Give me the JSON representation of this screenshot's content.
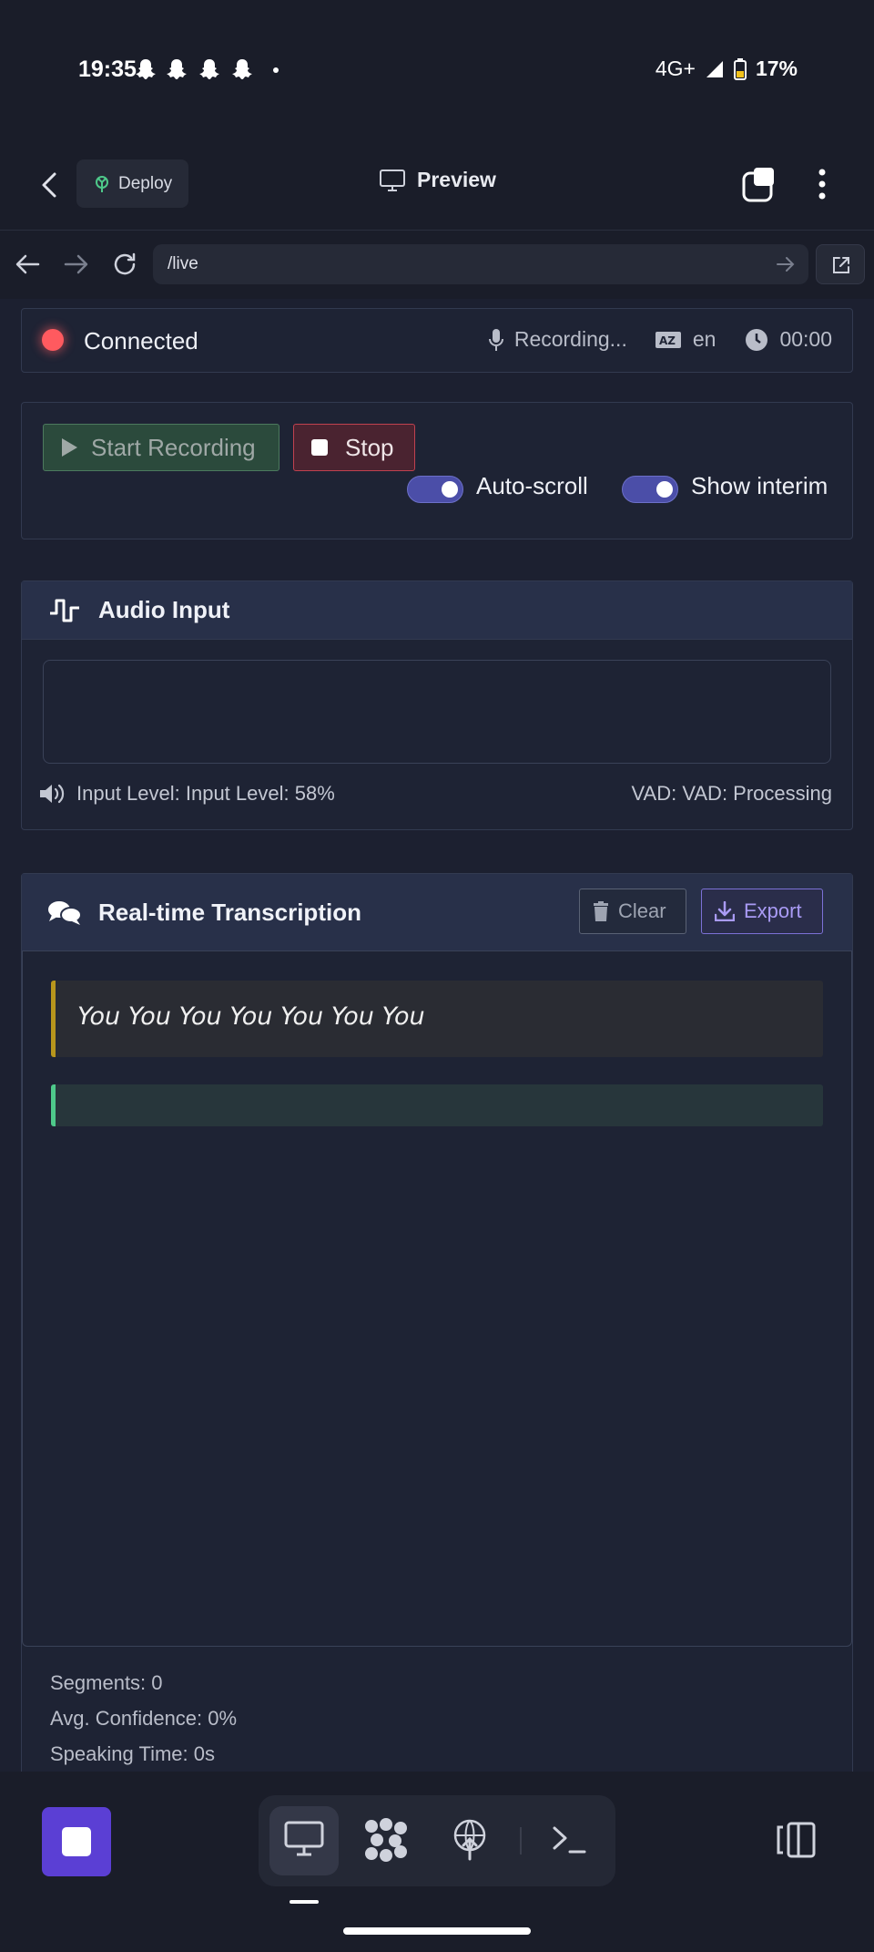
{
  "status_bar": {
    "time": "19:35",
    "network": "4G+",
    "battery": "17%"
  },
  "header": {
    "deploy_label": "Deploy",
    "preview_label": "Preview"
  },
  "url_bar": {
    "path": "/live"
  },
  "connection": {
    "status": "Connected",
    "recording": "Recording...",
    "language": "en",
    "timer": "00:00"
  },
  "controls": {
    "start_label": "Start Recording",
    "stop_label": "Stop",
    "autoscroll_label": "Auto-scroll",
    "interim_label": "Show interim",
    "autoscroll_on": true,
    "interim_on": true
  },
  "audio": {
    "title": "Audio Input",
    "level": "Input Level: Input Level: 58%",
    "vad": "VAD: VAD: Processing"
  },
  "transcription": {
    "title": "Real-time Transcription",
    "clear_label": "Clear",
    "export_label": "Export",
    "segment_text": "You You You You You You You",
    "stats": {
      "segments": "Segments: 0",
      "confidence": "Avg. Confidence: 0%",
      "speaking_time": "Speaking Time: 0s"
    }
  },
  "colors": {
    "accent": "#5b3fd4",
    "recording_led": "#ff5a5f",
    "final_segment": "#b8961c",
    "interim_segment": "#4ec98a"
  }
}
